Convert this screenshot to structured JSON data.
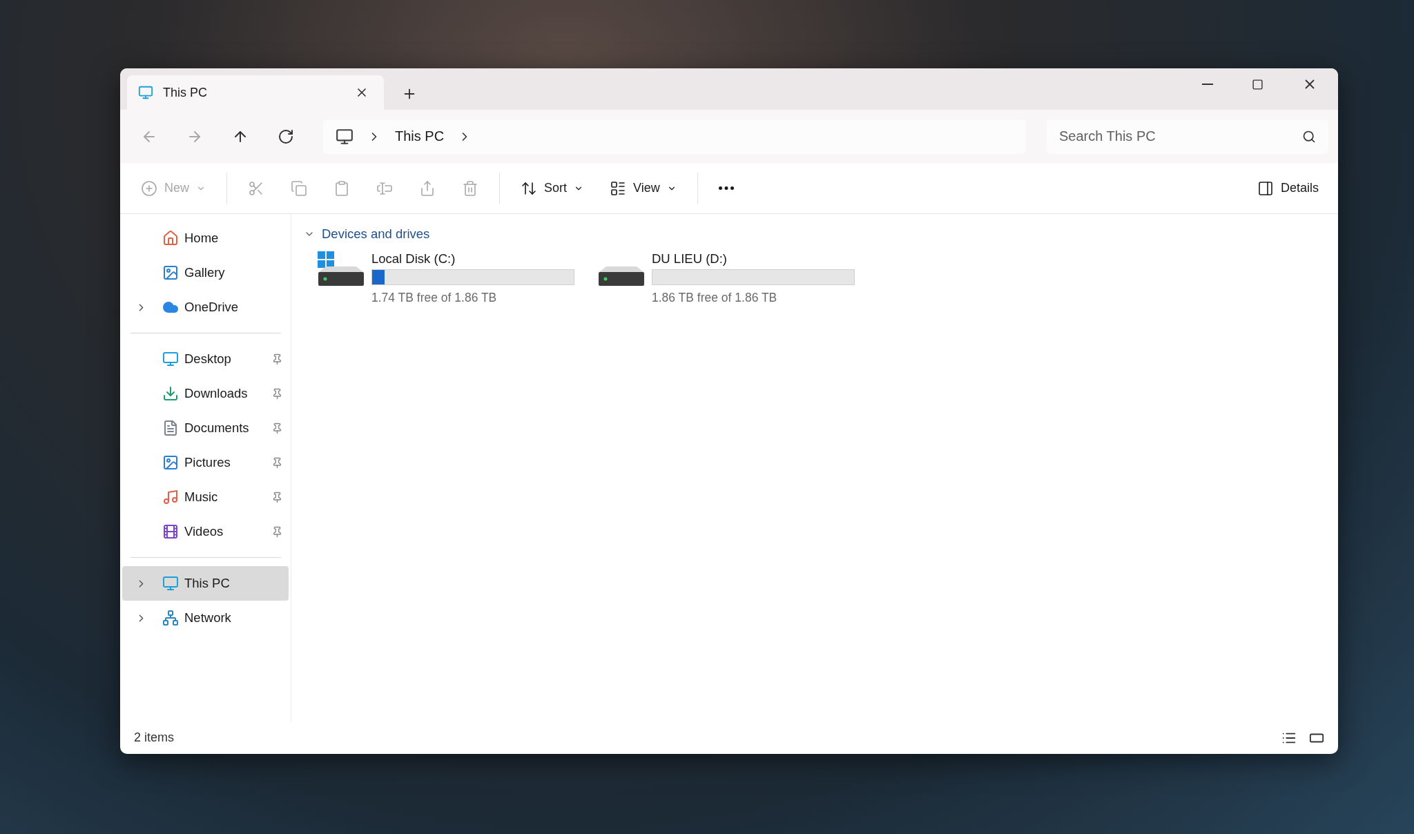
{
  "tabs": [
    {
      "title": "This PC",
      "selected": true
    }
  ],
  "navigation": [
    {
      "kind": "back",
      "disabled": true
    },
    {
      "kind": "forward",
      "disabled": true
    },
    {
      "kind": "up",
      "disabled": false
    },
    {
      "kind": "refresh",
      "disabled": false
    }
  ],
  "breadcrumb": [
    "This PC"
  ],
  "search": {
    "placeholder": "Search This PC"
  },
  "toolbar": [
    {
      "kind": "new",
      "label": "New",
      "disabled": true,
      "menu": true
    },
    {
      "kind": "cut",
      "disabled": true
    },
    {
      "kind": "copy",
      "disabled": true
    },
    {
      "kind": "paste",
      "disabled": true
    },
    {
      "kind": "rename",
      "disabled": true
    },
    {
      "kind": "share",
      "disabled": true
    },
    {
      "kind": "delete",
      "disabled": true
    },
    {
      "kind": "sort",
      "label": "Sort",
      "disabled": false,
      "menu": true
    },
    {
      "kind": "view",
      "label": "View",
      "disabled": false,
      "menu": true
    },
    {
      "kind": "more",
      "disabled": false
    }
  ],
  "details_button": "Details",
  "sidebar": {
    "groups": [
      [
        {
          "kind": "home",
          "label": "Home",
          "selected": false
        },
        {
          "kind": "gallery",
          "label": "Gallery",
          "selected": false
        },
        {
          "kind": "cloud",
          "label": "OneDrive",
          "selected": false,
          "expanded": false
        }
      ],
      [
        {
          "kind": "desktop",
          "label": "Desktop",
          "selected": false,
          "pinned": true
        },
        {
          "kind": "download",
          "label": "Downloads",
          "selected": false,
          "pinned": true
        },
        {
          "kind": "documents",
          "label": "Documents",
          "selected": false,
          "pinned": true
        },
        {
          "kind": "pictures",
          "label": "Pictures",
          "selected": false,
          "pinned": true
        },
        {
          "kind": "music",
          "label": "Music",
          "selected": false,
          "pinned": true
        },
        {
          "kind": "videos",
          "label": "Videos",
          "selected": false,
          "pinned": true
        }
      ],
      [
        {
          "kind": "pc",
          "label": "This PC",
          "selected": true,
          "expanded": false
        },
        {
          "kind": "network",
          "label": "Network",
          "selected": false,
          "expanded": false
        }
      ]
    ]
  },
  "section": {
    "title": "Devices and drives",
    "expanded": true,
    "drives": [
      {
        "name": "Local Disk (C:)",
        "free": "1.74 TB free of 1.86 TB",
        "level": 0.06,
        "system": true
      },
      {
        "name": "DU LIEU (D:)",
        "free": "1.86 TB free of 1.86 TB",
        "level": 0,
        "system": false
      }
    ]
  },
  "status_bar": {
    "count": "2 items"
  }
}
